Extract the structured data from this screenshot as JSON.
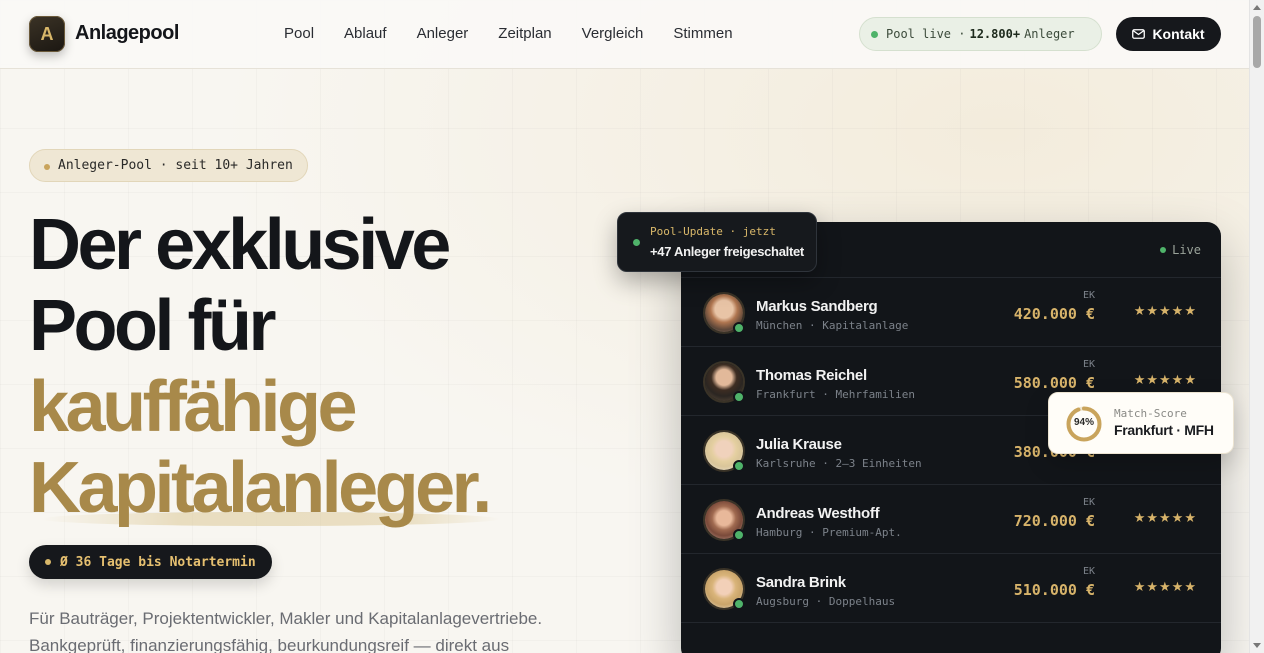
{
  "nav": {
    "logo_letter": "A",
    "brand": "Anlagepool",
    "links": [
      "Pool",
      "Ablauf",
      "Anleger",
      "Zeitplan",
      "Vergleich",
      "Stimmen"
    ],
    "status_prefix": "Pool live ·",
    "status_count": "12.800+",
    "status_suffix": "Anleger",
    "contact_label": "Kontakt"
  },
  "hero": {
    "badge": "Anleger-Pool · seit 10+ Jahren",
    "headline_line1": "Der exklusive",
    "headline_line2": "Pool für",
    "headline_line3": "kauffähige",
    "headline_line4": "Kapitalanleger.",
    "notar_pill": "Ø 36 Tage bis Notartermin",
    "intro": "Für Bauträger, Projektentwickler, Makler und Kapitalanlagevertriebe. Bankgeprüft, finanzierungsfähig, beurkundungsreif — direkt aus"
  },
  "panel": {
    "title_fragment": "l",
    "live_label": "Live",
    "ek_label": "EK",
    "rows": [
      {
        "name": "Markus Sandberg",
        "sub": "München · Kapitalanlage",
        "ek": "420.000 €",
        "stars": "★★★★★"
      },
      {
        "name": "Thomas Reichel",
        "sub": "Frankfurt · Mehrfamilien",
        "ek": "580.000 €",
        "stars": "★★★★★"
      },
      {
        "name": "Julia Krause",
        "sub": "Karlsruhe · 2–3 Einheiten",
        "ek": "380.000 €",
        "stars": "★★★★☆"
      },
      {
        "name": "Andreas Westhoff",
        "sub": "Hamburg · Premium-Apt.",
        "ek": "720.000 €",
        "stars": "★★★★★"
      },
      {
        "name": "Sandra Brink",
        "sub": "Augsburg · Doppelhaus",
        "ek": "510.000 €",
        "stars": "★★★★★"
      }
    ]
  },
  "update_card": {
    "title": "Pool-Update · jetzt",
    "text": "+47 Anleger freigeschaltet"
  },
  "match_card": {
    "percent_label": "94%",
    "percent": 94,
    "label": "Match-Score",
    "value": "Frankfurt · MFH"
  },
  "colors": {
    "gold": "#a8894a",
    "dark": "#14161a",
    "live_green": "#4fb36a",
    "panel_bg": "#121519"
  },
  "icons": {
    "contact": "mail-icon"
  }
}
